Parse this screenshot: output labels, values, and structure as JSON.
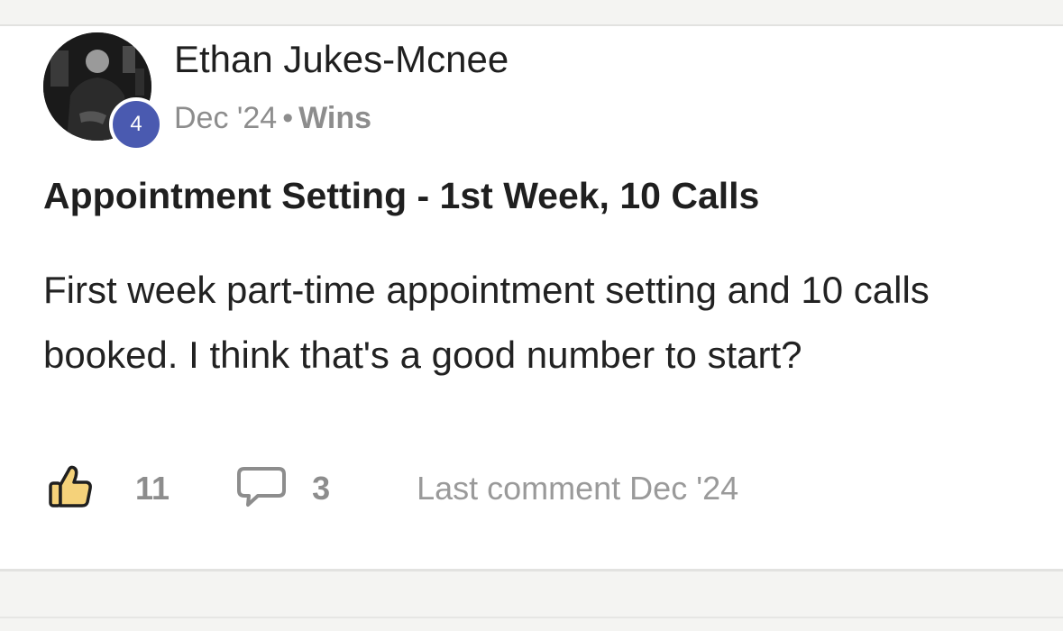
{
  "post": {
    "author": {
      "name": "Ethan Jukes-Mcnee",
      "level": "4"
    },
    "meta": {
      "date": "Dec '24",
      "separator": "•",
      "category": "Wins"
    },
    "title": "Appointment Setting - 1st Week, 10 Calls",
    "body": "First week part-time appointment setting and 10 calls booked. I think that's a good number to start?",
    "actions": {
      "like_icon": "thumbs-up-icon",
      "likes": "11",
      "comment_icon": "comment-bubble-icon",
      "comments": "3",
      "last_comment": "Last comment Dec '24"
    }
  },
  "colors": {
    "level_badge": "#4a5ab0",
    "like_fill": "#f5d27a",
    "muted_text": "#8d8d8d"
  }
}
